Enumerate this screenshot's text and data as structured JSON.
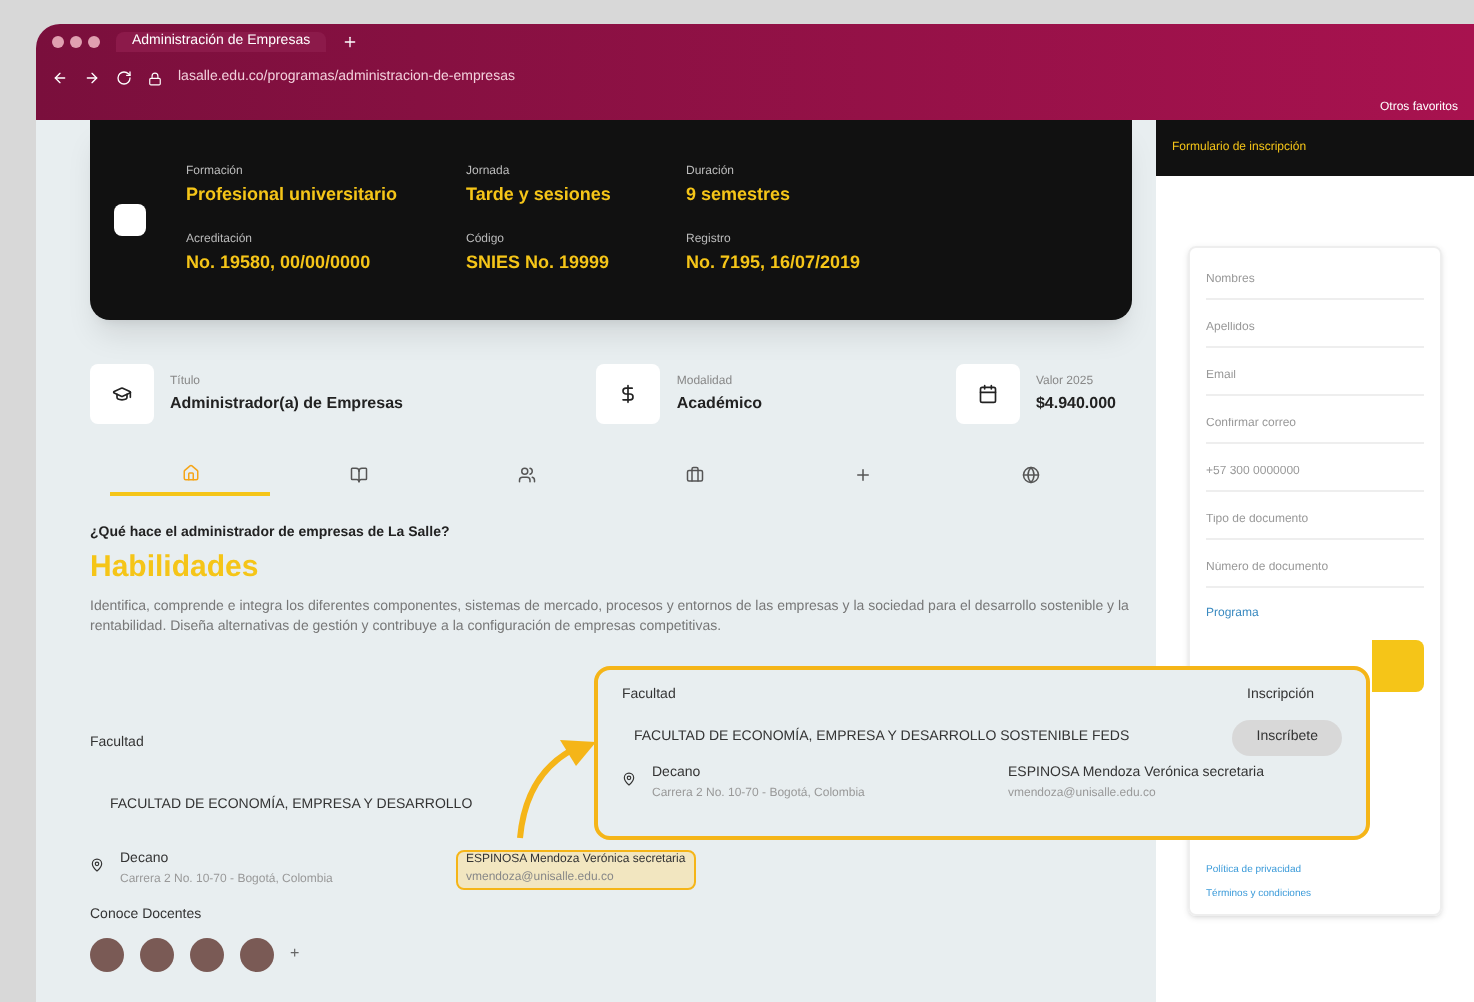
{
  "browser": {
    "tab_title": "Administración de Empresas",
    "address": "lasalle.edu.co/programas/administracion-de-empresas",
    "profile": "Otros favoritos"
  },
  "header": {
    "facts": [
      {
        "label": "Formación",
        "value": "Profesional universitario"
      },
      {
        "label": "Jornada",
        "value": "Tarde y sesiones"
      },
      {
        "label": "Duración",
        "value": "9 semestres"
      },
      {
        "label": "Acreditación",
        "value": "No. 19580, 00/00/0000"
      },
      {
        "label": "Código",
        "value": "SNIES No. 19999"
      },
      {
        "label": "Registro",
        "value": "No. 7195, 16/07/2019"
      }
    ]
  },
  "summary": [
    {
      "label": "Título",
      "value": "Administrador(a) de Empresas"
    },
    {
      "label": "Modalidad",
      "value": "Académico"
    },
    {
      "label": "Valor 2025",
      "value": "$4.940.000"
    }
  ],
  "section_tabs": [
    {
      "selected": true
    },
    {
      "selected": false
    },
    {
      "selected": false
    },
    {
      "selected": false
    },
    {
      "selected": false
    },
    {
      "selected": false
    }
  ],
  "content": {
    "question": "¿Qué hace el administrador de empresas de La Salle?",
    "heading": "Habilidades",
    "paragraph": "Identifica, comprende e integra los diferentes componentes, sistemas de mercado, procesos y entornos de las empresas y la sociedad para el desarrollo sostenible y la rentabilidad. Diseña alternativas de gestión y contribuye a la configuración de empresas competitivas."
  },
  "faculty": {
    "label": "Facultad",
    "name": "FACULTAD DE ECONOMÍA, EMPRESA Y DESARROLLO",
    "person": "Decano",
    "person_detail": "Carrera 2 No. 10-70 - Bogotá, Colombia"
  },
  "tooltip": {
    "title": "ESPINOSA Mendoza Verónica secretaria",
    "detail": "vmendoza@unisalle.edu.co"
  },
  "teachers": {
    "label": "Conoce Docentes",
    "more": "+"
  },
  "callout": {
    "label": "Facultad",
    "side_label": "Inscripción",
    "name": "FACULTAD DE ECONOMÍA, EMPRESA Y DESARROLLO SOSTENIBLE FEDS",
    "button": "Inscríbete",
    "person": "Decano",
    "person_detail": "Carrera 2 No. 10-70 - Bogotá, Colombia",
    "contact": "ESPINOSA Mendoza Verónica secretaria",
    "contact_detail": "vmendoza@unisalle.edu.co"
  },
  "form": {
    "title": "Formulario de inscripción",
    "fields": [
      {
        "placeholder": "Nombres"
      },
      {
        "placeholder": "Apellidos"
      },
      {
        "placeholder": "Email"
      },
      {
        "placeholder": "Confirmar correo"
      },
      {
        "placeholder": "+57 300 0000000"
      },
      {
        "placeholder": "Tipo de documento"
      },
      {
        "placeholder": "Número de documento"
      }
    ],
    "program": "Programa",
    "links": [
      "Política de privacidad",
      "Términos y condiciones"
    ]
  }
}
